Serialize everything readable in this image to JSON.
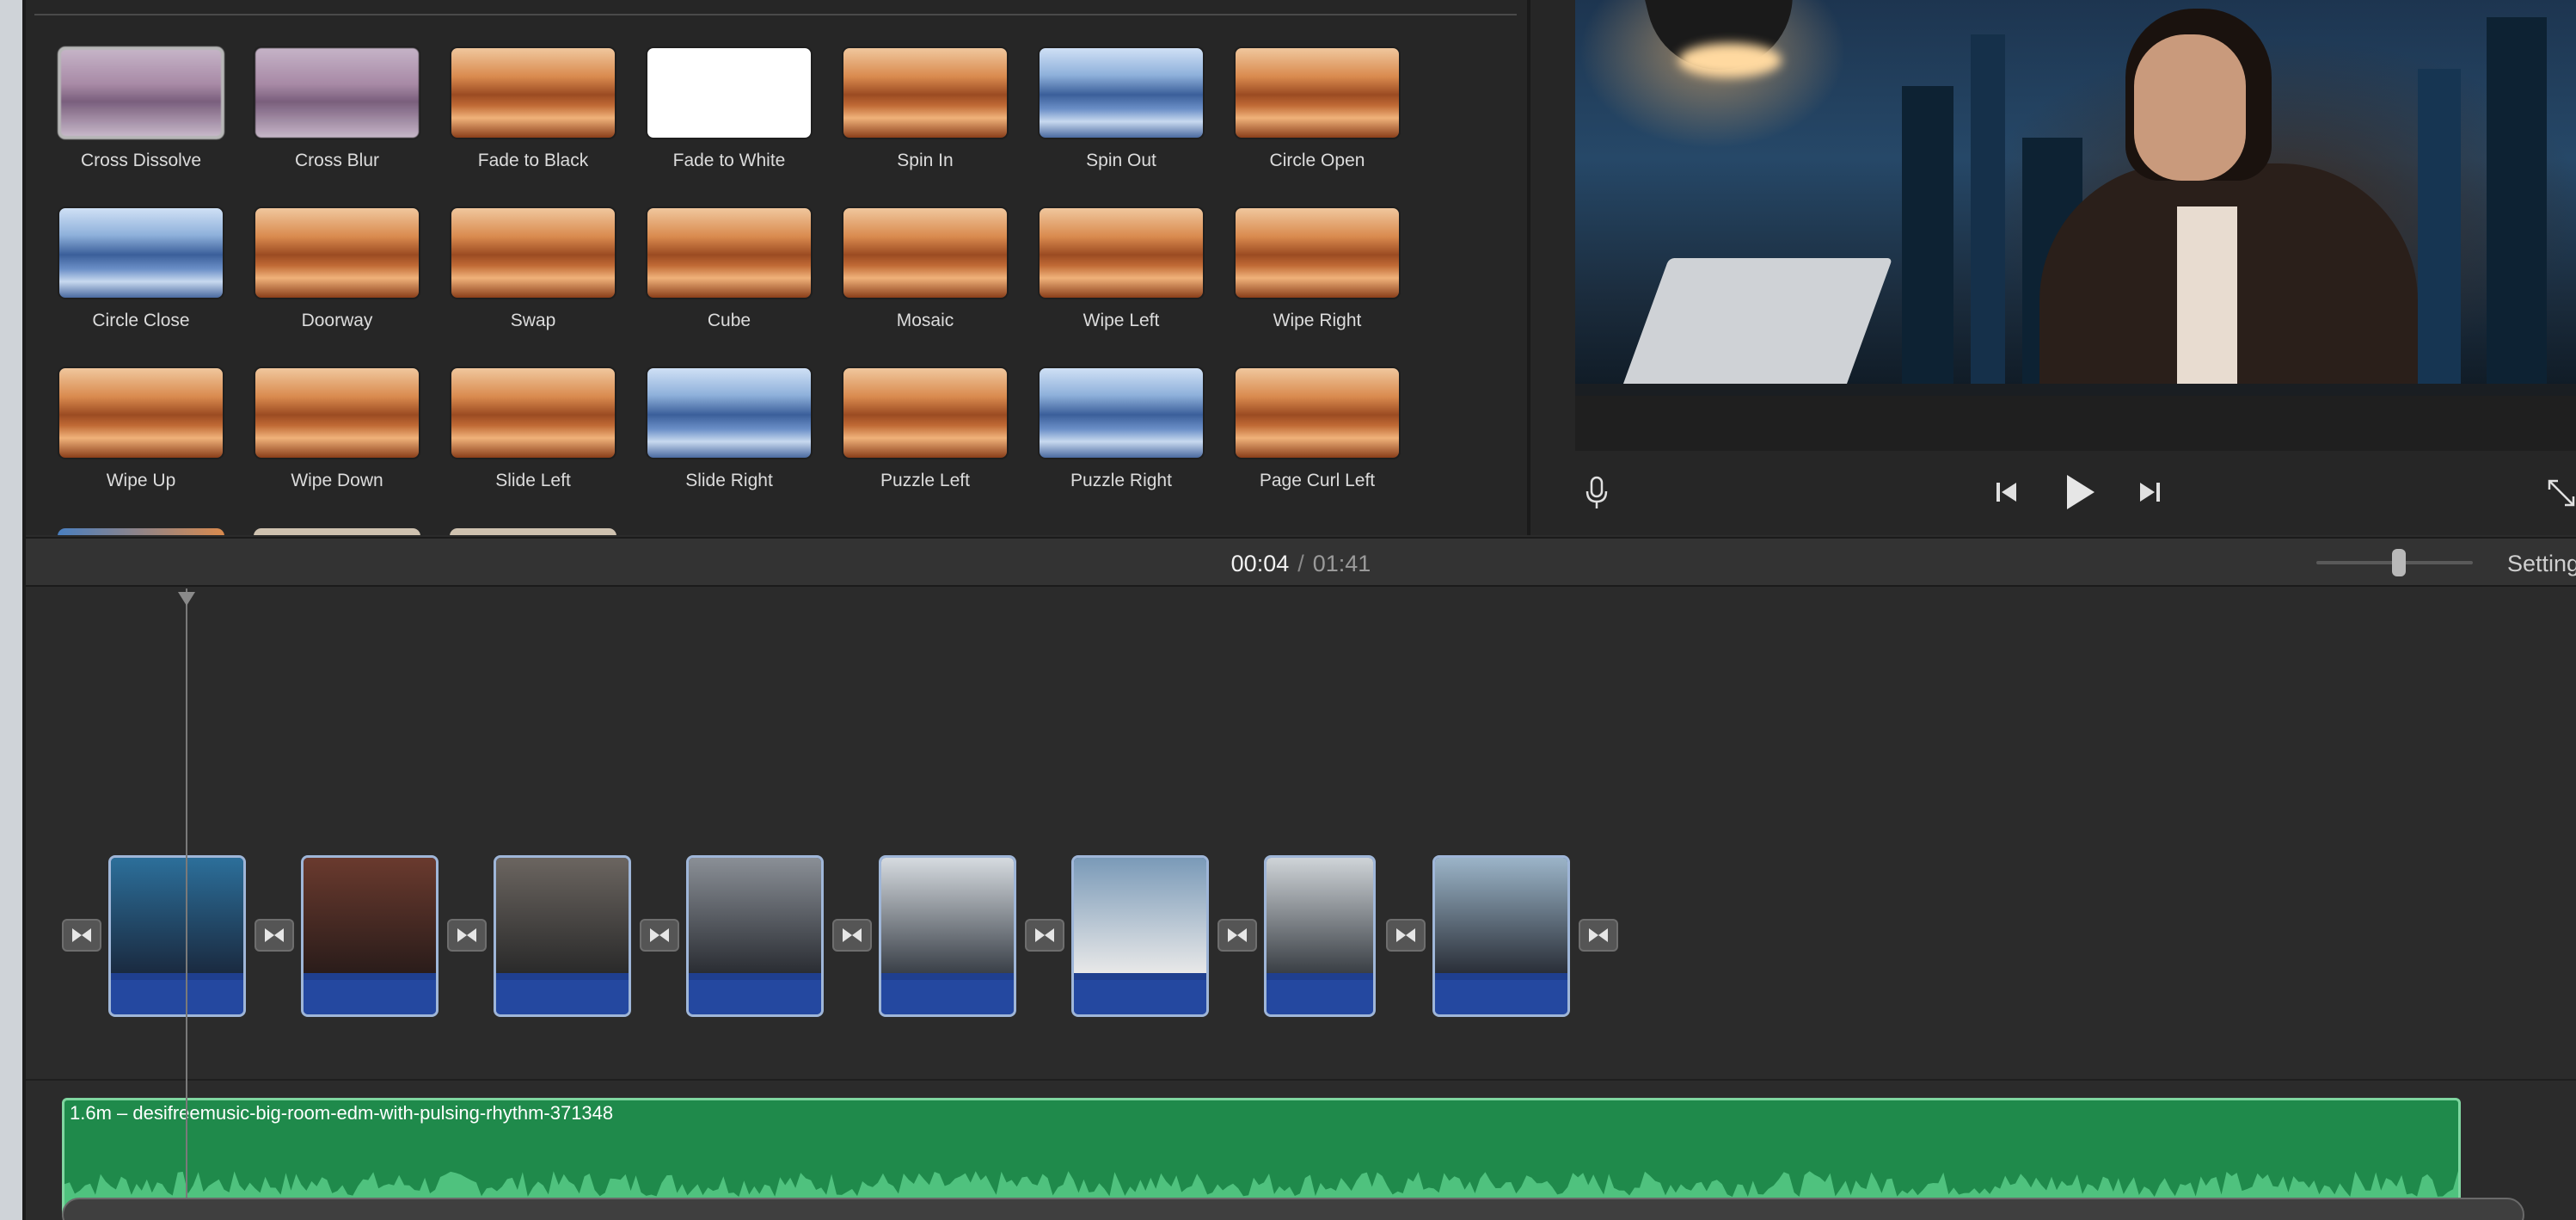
{
  "transitions": [
    {
      "label": "Cross Dissolve",
      "style": "blur",
      "selected": true
    },
    {
      "label": "Cross Blur",
      "style": "blur"
    },
    {
      "label": "Fade to Black",
      "style": "mtn"
    },
    {
      "label": "Fade to White",
      "style": "white"
    },
    {
      "label": "Spin In",
      "style": "mtn"
    },
    {
      "label": "Spin Out",
      "style": "mtn-blue"
    },
    {
      "label": "Circle Open",
      "style": "mtn"
    },
    {
      "label": "Circle Close",
      "style": "mtn-blue"
    },
    {
      "label": "Doorway",
      "style": "mtn"
    },
    {
      "label": "Swap",
      "style": "mtn"
    },
    {
      "label": "Cube",
      "style": "mtn"
    },
    {
      "label": "Mosaic",
      "style": "mtn"
    },
    {
      "label": "Wipe Left",
      "style": "mtn"
    },
    {
      "label": "Wipe Right",
      "style": "mtn"
    },
    {
      "label": "Wipe Up",
      "style": "mtn"
    },
    {
      "label": "Wipe Down",
      "style": "mtn"
    },
    {
      "label": "Slide Left",
      "style": "mtn"
    },
    {
      "label": "Slide Right",
      "style": "mtn-blue"
    },
    {
      "label": "Puzzle Left",
      "style": "mtn"
    },
    {
      "label": "Puzzle Right",
      "style": "mtn-blue"
    },
    {
      "label": "Page Curl Left",
      "style": "mtn"
    }
  ],
  "timecode": {
    "current": "00:04",
    "separator": "/",
    "total": "01:41"
  },
  "timeline": {
    "settings_label": "Settings",
    "zoom_level": 0.5
  },
  "clips": [
    {
      "name": "clip-1",
      "colors": [
        "#2c6f9a",
        "#1a2a40"
      ]
    },
    {
      "name": "clip-2",
      "colors": [
        "#6a3a2e",
        "#2a1c1a"
      ]
    },
    {
      "name": "clip-3",
      "colors": [
        "#6b6560",
        "#2a2a2a"
      ]
    },
    {
      "name": "clip-4",
      "colors": [
        "#8a8f96",
        "#2a2d33"
      ]
    },
    {
      "name": "clip-5",
      "colors": [
        "#d6dbe0",
        "#3a4048"
      ]
    },
    {
      "name": "clip-6",
      "colors": [
        "#7a9ab8",
        "#e8e8e8"
      ]
    },
    {
      "name": "clip-7",
      "colors": [
        "#cfd4d8",
        "#3a3f45"
      ]
    },
    {
      "name": "clip-8",
      "colors": [
        "#9bb4c8",
        "#2a2f38"
      ]
    }
  ],
  "music": {
    "title": "1.6m – desifreemusic-big-room-edm-with-pulsing-rhythm-371348"
  },
  "colors": {
    "audio_green": "#1f8a4b",
    "clip_blue": "#2448a0",
    "panel": "#262626"
  }
}
